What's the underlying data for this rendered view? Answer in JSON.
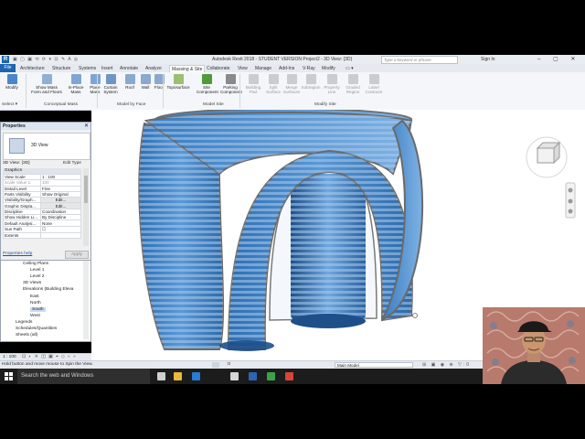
{
  "app": {
    "logo": "R",
    "qat": "▣ ▢ ▣ ⟲ ⟳ ▾ ⊡ ✎ A ◎",
    "title": "Autodesk Revit 2018 - STUDENT VERSION    Project2 - 3D View: {3D}",
    "search_placeholder": "Type a keyword or phrase",
    "sign_in": "Sign In",
    "window_buttons": "– ▢ ✕"
  },
  "tabs": [
    {
      "label": "File",
      "kind": "file"
    },
    {
      "label": "Architecture"
    },
    {
      "label": "Structure"
    },
    {
      "label": "Systems"
    },
    {
      "label": "Insert"
    },
    {
      "label": "Annotate"
    },
    {
      "label": "Analyze"
    },
    {
      "label": "Massing & Site",
      "active": true
    },
    {
      "label": "Collaborate"
    },
    {
      "label": "View"
    },
    {
      "label": "Manage"
    },
    {
      "label": "Add-Ins"
    },
    {
      "label": "V-Ray"
    },
    {
      "label": "Modify"
    },
    {
      "label": "▭ ▾"
    }
  ],
  "ribbon": {
    "buttons": [
      {
        "label": "Modify",
        "color": "#4a86c8",
        "enabled": true
      },
      {
        "label": "Show Mass\nForm and Floors",
        "color": "#8fb0d6",
        "enabled": true
      },
      {
        "label": "In-Place\nMass",
        "color": "#7fa5d3",
        "enabled": true
      },
      {
        "label": "Place\nMass",
        "color": "#7fa5d3",
        "enabled": true
      },
      {
        "label": "Curtain\nSystem",
        "color": "#6f95c8",
        "enabled": true
      },
      {
        "label": "Roof",
        "color": "#8aa9cf",
        "enabled": true
      },
      {
        "label": "Wall",
        "color": "#8aa9cf",
        "enabled": true
      },
      {
        "label": "Floor",
        "color": "#8aa9cf",
        "enabled": true
      },
      {
        "label": "Toposurface",
        "color": "#9cbf72",
        "enabled": true
      },
      {
        "label": "Site\nComponent",
        "color": "#4f9a3b",
        "enabled": true
      },
      {
        "label": "Parking\nComponent",
        "color": "#8a8a8a",
        "enabled": true
      },
      {
        "label": "Building\nPad",
        "color": "#c9ccd1",
        "enabled": false
      },
      {
        "label": "Split\nSurface",
        "color": "#c9ccd1",
        "enabled": false
      },
      {
        "label": "Merge\nSurfaces",
        "color": "#c9ccd1",
        "enabled": false
      },
      {
        "label": "Subregion",
        "color": "#c9ccd1",
        "enabled": false
      },
      {
        "label": "Property\nLine",
        "color": "#c9ccd1",
        "enabled": false
      },
      {
        "label": "Graded\nRegion",
        "color": "#c9ccd1",
        "enabled": false
      },
      {
        "label": "Label\nContours",
        "color": "#c9ccd1",
        "enabled": false
      }
    ],
    "panels": [
      "Select ▾",
      "Conceptual Mass",
      "Model by Face",
      "Model Site",
      "Modify Site"
    ]
  },
  "properties": {
    "title": "Properties",
    "close": "✕",
    "type_name": "3D View",
    "filter": "3D View: {3D}",
    "edit_type": "Edit Type",
    "group": "Graphics",
    "rows": [
      {
        "k": "View Scale",
        "v": "1 : 100"
      },
      {
        "k": "Scale Value  1:",
        "v": "100",
        "dim": true
      },
      {
        "k": "Detail Level",
        "v": "Fine"
      },
      {
        "k": "Parts Visibility",
        "v": "Show Original"
      },
      {
        "k": "Visibility/Graph...",
        "v": "Edit..."
      },
      {
        "k": "Graphic Displa...",
        "v": "Edit..."
      },
      {
        "k": "Discipline",
        "v": "Coordination"
      },
      {
        "k": "Show Hidden Li...",
        "v": "By Discipline"
      },
      {
        "k": "Default Analysi...",
        "v": "None"
      },
      {
        "k": "Sun Path",
        "v": "☐"
      },
      {
        "k": "Extents",
        "v": ""
      }
    ],
    "help": "Properties help",
    "apply": "Apply"
  },
  "browser": {
    "nodes": [
      {
        "label": "Ceiling Plans",
        "indent": 3
      },
      {
        "label": "Level 1",
        "indent": 4
      },
      {
        "label": "Level 2",
        "indent": 4
      },
      {
        "label": "3D Views",
        "indent": 3
      },
      {
        "label": "Elevations (Building Eleva",
        "indent": 3
      },
      {
        "label": "East",
        "indent": 4
      },
      {
        "label": "North",
        "indent": 4
      },
      {
        "label": "South",
        "indent": 4,
        "selected": true
      },
      {
        "label": "West",
        "indent": 4
      },
      {
        "label": "Legends",
        "indent": 2
      },
      {
        "label": "Schedules/Quantities",
        "indent": 2
      },
      {
        "label": "Sheets (all)",
        "indent": 2
      }
    ]
  },
  "view_bar": {
    "scale": "1 : 100",
    "icons": "⊡ ◐ ☀ ◫ ▣ ⌖ ◇ « »"
  },
  "status": {
    "message": "Hold button and move mouse to Spin the View.",
    "count": ":0",
    "model": "Main Model",
    "right_icons": "⊞ ▣ ◉ ⊕ ▽:0"
  },
  "taskbar": {
    "search": "Search the web and Windows",
    "icons": [
      {
        "name": "task-view-icon",
        "color": "#cfcfcf"
      },
      {
        "name": "file-explorer-icon",
        "color": "#e8b93a"
      },
      {
        "name": "edge-icon",
        "color": "#2a7bd4"
      },
      {
        "name": "photos-icon",
        "color": "#d6d6d6"
      },
      {
        "name": "revit-icon",
        "color": "#2f63b4"
      },
      {
        "name": "camtasia-icon",
        "color": "#3aa34a"
      },
      {
        "name": "recorder-icon",
        "color": "#d9443a"
      }
    ]
  },
  "colors": {
    "glass": "#3f7fc0",
    "glass_light": "#8fb8e6",
    "frame": "#6f6f6f",
    "accent": "#1f64b0"
  }
}
